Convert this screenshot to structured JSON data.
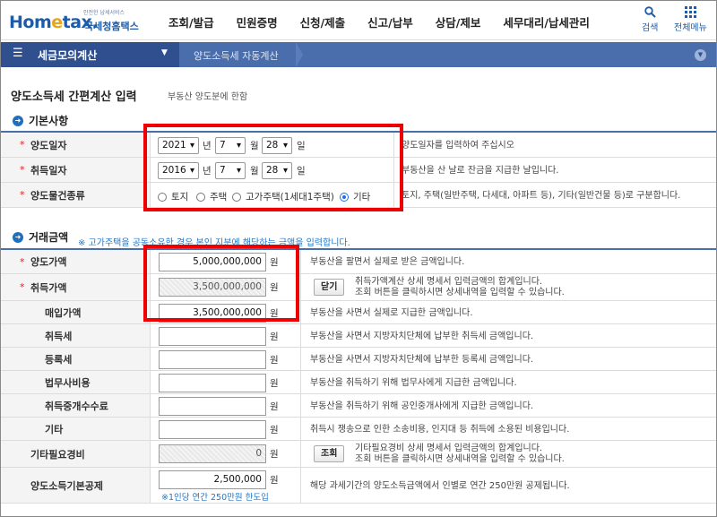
{
  "header": {
    "logo_main_a": "Hom",
    "logo_main_e": "e",
    "logo_main_b": "tax.",
    "logo_sub": "국세청홈택스",
    "logo_tiny": "안전한 납세서비스",
    "nav": [
      "조회/발급",
      "민원증명",
      "신청/제출",
      "신고/납부",
      "상담/제보",
      "세무대리/납세관리"
    ],
    "search_label": "검색",
    "allmenu_label": "전체메뉴"
  },
  "bluebar": {
    "menu_title": "세금모의계산",
    "submenu": "양도소득세 자동계산"
  },
  "page": {
    "title": "양도소득세 간편계산 입력",
    "subtitle": "부동산 양도분에 한함"
  },
  "basic": {
    "heading": "기본사항",
    "transfer_date": {
      "label": "양도일자",
      "year": "2021",
      "month": "7",
      "day": "28",
      "year_unit": "년",
      "month_unit": "월",
      "day_unit": "일",
      "desc": "양도일자를 입력하여 주십시오"
    },
    "acquire_date": {
      "label": "취득일자",
      "year": "2016",
      "month": "7",
      "day": "28",
      "year_unit": "년",
      "month_unit": "월",
      "day_unit": "일",
      "desc": "부동산을 산 날로 잔금을 지급한 날입니다."
    },
    "property_type": {
      "label": "양도물건종류",
      "options": [
        "토지",
        "주택",
        "고가주택(1세대1주택)",
        "기타"
      ],
      "selected": "기타",
      "desc": "토지, 주택(일반주택, 다세대, 아파트 등), 기타(일반건물 등)로 구분합니다."
    }
  },
  "amounts": {
    "heading": "거래금액",
    "note": "※ 고가주택을 공동소유한 경우 본인 지분에 해당하는 금액을 입력합니다.",
    "unit": "원",
    "rows": [
      {
        "label": "양도가액",
        "value": "5,000,000,000",
        "desc1": "부동산을 팔면서 실제로 받은 금액입니다.",
        "desc2": ""
      },
      {
        "label": "취득가액",
        "value": "3,500,000,000",
        "button": "닫기",
        "desc1": "취득가액계산 상세 명세서 입력금액의 합계입니다.",
        "desc2": "조회 버튼을 클릭하시면 상세내역을 입력할 수 있습니다."
      },
      {
        "label": "매입가액",
        "value": "3,500,000,000",
        "desc1": "부동산을 사면서 실제로 지급한 금액입니다.",
        "desc2": ""
      },
      {
        "label": "취득세",
        "value": "",
        "desc1": "부동산을 사면서 지방자치단체에 납부한 취득세 금액입니다.",
        "desc2": ""
      },
      {
        "label": "등록세",
        "value": "",
        "desc1": "부동산을 사면서 지방자치단체에 납부한 등록세 금액입니다.",
        "desc2": ""
      },
      {
        "label": "법무사비용",
        "value": "",
        "desc1": "부동산을 취득하기 위해 법무사에게 지급한 금액입니다.",
        "desc2": ""
      },
      {
        "label": "취득중개수수료",
        "value": "",
        "desc1": "부동산을 취득하기 위해 공인중개사에게 지급한 금액입니다.",
        "desc2": ""
      },
      {
        "label": "기타",
        "value": "",
        "desc1": "취득시 쟁송으로 인한 소송비용, 인지대 등 취득에 소용된 비용입니다.",
        "desc2": ""
      },
      {
        "label": "기타필요경비",
        "value": "0",
        "button": "조회",
        "desc1": "기타필요경비 상세 명세서 입력금액의 합계입니다.",
        "desc2": "조회 버튼을 클릭하시면 상세내역을 입력할 수 있습니다."
      },
      {
        "label": "양도소득기본공제",
        "value": "2,500,000",
        "note": "※1인당 연간 250만원 한도입",
        "desc1": "해당 과세기간의 양도소득금액에서 인별로 연간 250만원 공제됩니다.",
        "desc2": ""
      }
    ]
  },
  "colors": {
    "brand": "#1f5ca8",
    "bar": "#4a6dab",
    "highlight": "#e00000",
    "required": "#dd2222"
  }
}
